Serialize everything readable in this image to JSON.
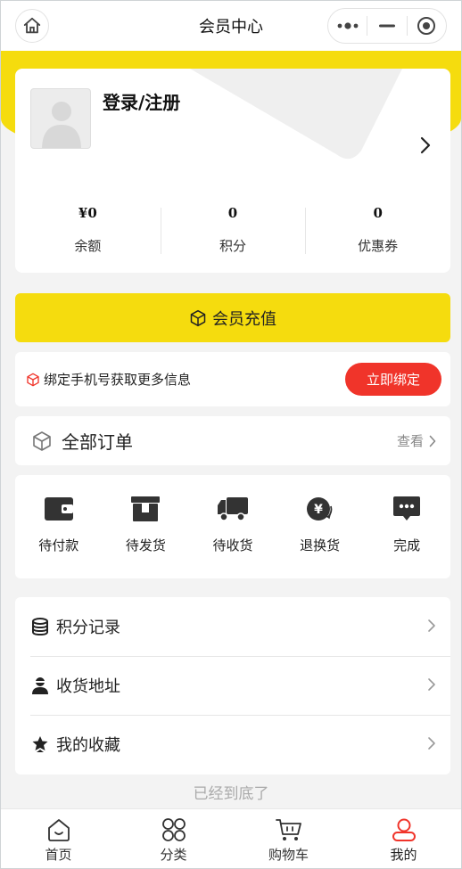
{
  "nav": {
    "title": "会员中心",
    "home_icon": "home-icon",
    "more_icon": "more-dots-icon",
    "minimize_icon": "minimize-icon",
    "close_icon": "target-close-icon"
  },
  "profile": {
    "login_text": "登录/注册",
    "stats": [
      {
        "value": "¥0",
        "label": "余额"
      },
      {
        "value": "0",
        "label": "积分"
      },
      {
        "value": "0",
        "label": "优惠券"
      }
    ]
  },
  "recharge": {
    "label": "会员充值",
    "icon": "cube-icon"
  },
  "bind": {
    "text": "绑定手机号获取更多信息",
    "button_label": "立即绑定",
    "icon": "cube-icon"
  },
  "orders": {
    "title": "全部订单",
    "view_label": "查看",
    "statuses": [
      {
        "label": "待付款",
        "icon": "wallet-icon"
      },
      {
        "label": "待发货",
        "icon": "box-icon"
      },
      {
        "label": "待收货",
        "icon": "truck-icon"
      },
      {
        "label": "退换货",
        "icon": "yen-refund-icon"
      },
      {
        "label": "完成",
        "icon": "chat-bubble-icon"
      }
    ]
  },
  "menu": {
    "items": [
      {
        "label": "积分记录",
        "icon": "database-icon"
      },
      {
        "label": "收货地址",
        "icon": "person-icon"
      },
      {
        "label": "我的收藏",
        "icon": "star-badge-icon"
      }
    ]
  },
  "bottom_hint": "已经到底了",
  "tabs": [
    {
      "label": "首页",
      "icon": "home-smile-icon",
      "active": false
    },
    {
      "label": "分类",
      "icon": "grid-circles-icon",
      "active": false
    },
    {
      "label": "购物车",
      "icon": "cart-icon",
      "active": false
    },
    {
      "label": "我的",
      "icon": "user-icon",
      "active": true
    }
  ],
  "colors": {
    "accent_yellow": "#f5dc0e",
    "bind_button": "#f0342a",
    "active_tab": "#f0342a",
    "background": "#f3f3f3"
  }
}
